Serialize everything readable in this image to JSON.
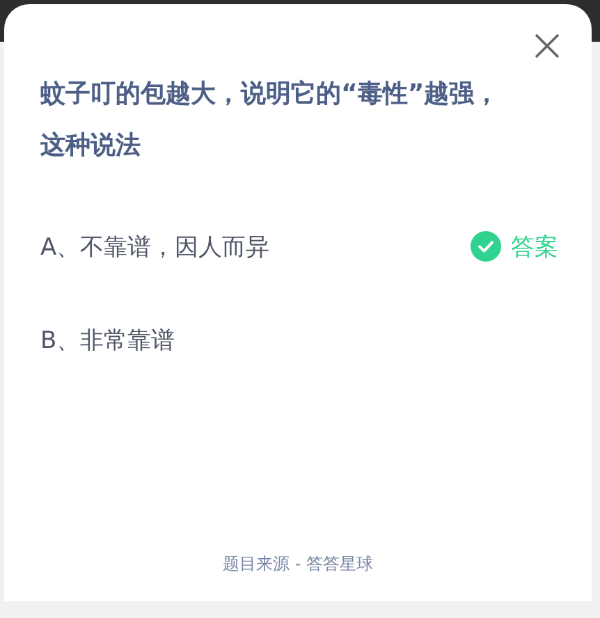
{
  "question": "蚊子叮的包越大，说明它的“毒性”越强，这种说法",
  "options": [
    {
      "label": "A、不靠谱，因人而异",
      "is_answer": true
    },
    {
      "label": "B、非常靠谱",
      "is_answer": false
    }
  ],
  "answer_label": "答案",
  "footer": "题目来源 - 答答星球"
}
